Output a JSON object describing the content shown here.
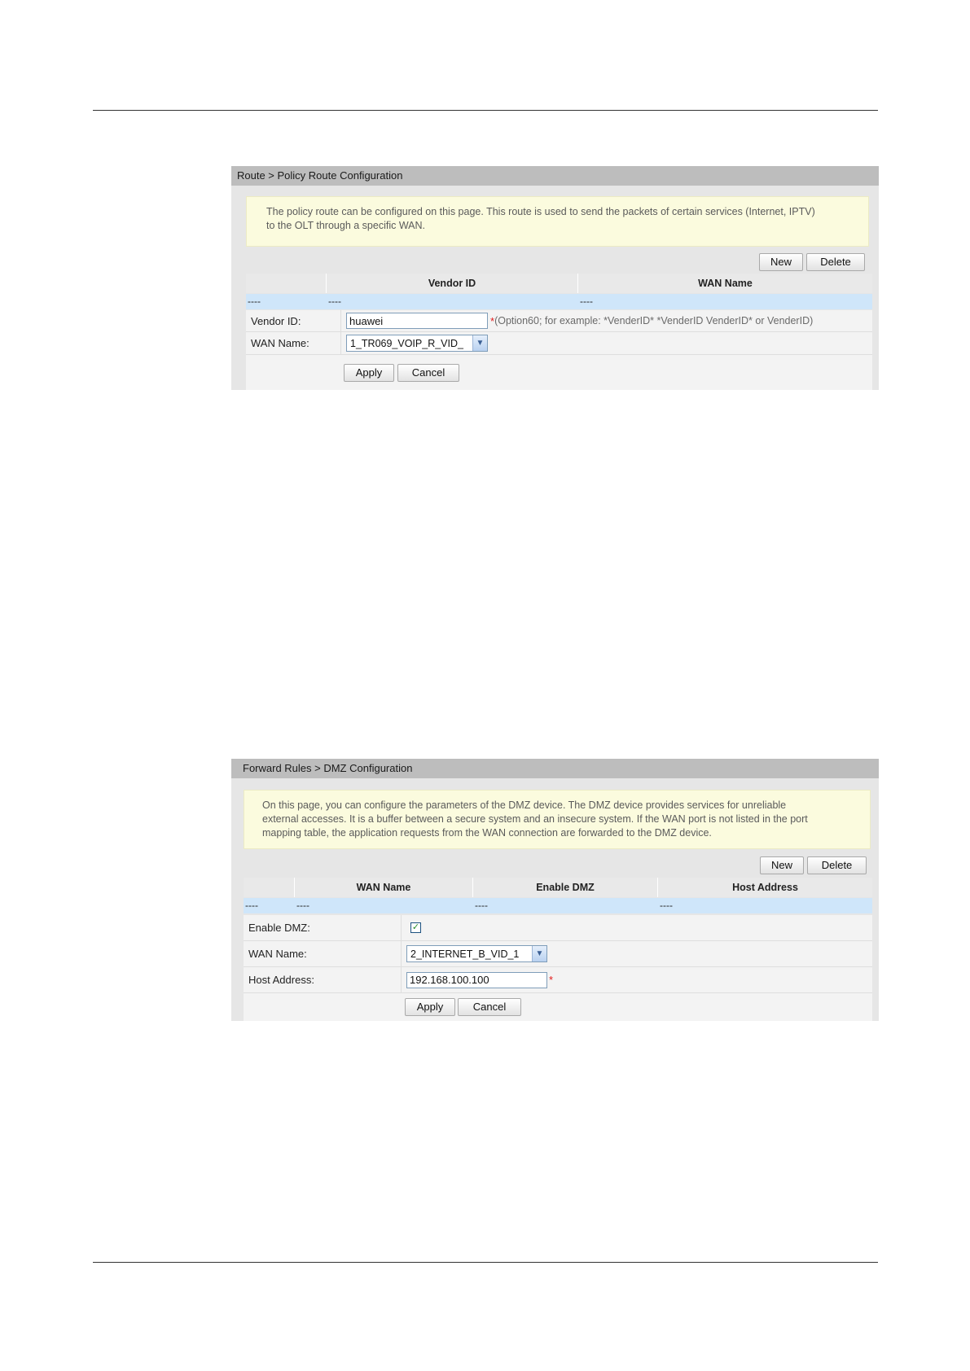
{
  "policy_route": {
    "breadcrumb": "Route > Policy Route Configuration",
    "notice_line1": "The policy route can be configured on this page. This route is used to send the packets of certain services (Internet, IPTV)",
    "notice_line2": "to the OLT through a specific WAN.",
    "new_label": "New",
    "delete_label": "Delete",
    "columns": [
      "",
      "Vendor ID",
      "WAN Name"
    ],
    "row": [
      "----",
      "----",
      "----"
    ],
    "vendor_id_label": "Vendor ID:",
    "vendor_id_value": "huawei",
    "vendor_id_required": "*",
    "vendor_id_hint": "(Option60; for example: *VenderID* *VenderID VenderID* or VenderID)",
    "wan_name_label": "WAN Name:",
    "wan_name_value": "1_TR069_VOIP_R_VID_",
    "apply_label": "Apply",
    "cancel_label": "Cancel"
  },
  "dmz": {
    "breadcrumb": "Forward Rules > DMZ Configuration",
    "notice_line1": "On this page, you can configure the parameters of the DMZ device. The DMZ device provides services for unreliable",
    "notice_line2": "external accesses. It is a buffer between a secure system and an insecure system. If the WAN port is not listed in the port",
    "notice_line3": "mapping table, the application requests from the WAN connection are forwarded to the DMZ device.",
    "new_label": "New",
    "delete_label": "Delete",
    "columns": [
      "",
      "WAN Name",
      "Enable DMZ",
      "Host Address"
    ],
    "row": [
      "----",
      "----",
      "----",
      "----"
    ],
    "enable_label": "Enable DMZ:",
    "enable_checked": true,
    "check_glyph": "✓",
    "wan_name_label": "WAN Name:",
    "wan_name_value": "2_INTERNET_B_VID_1",
    "host_label": "Host Address:",
    "host_value": "192.168.100.100",
    "host_required": "*",
    "apply_label": "Apply",
    "cancel_label": "Cancel"
  },
  "icons": {
    "dropdown": "chevron-down-icon",
    "check": "checkmark-icon"
  }
}
